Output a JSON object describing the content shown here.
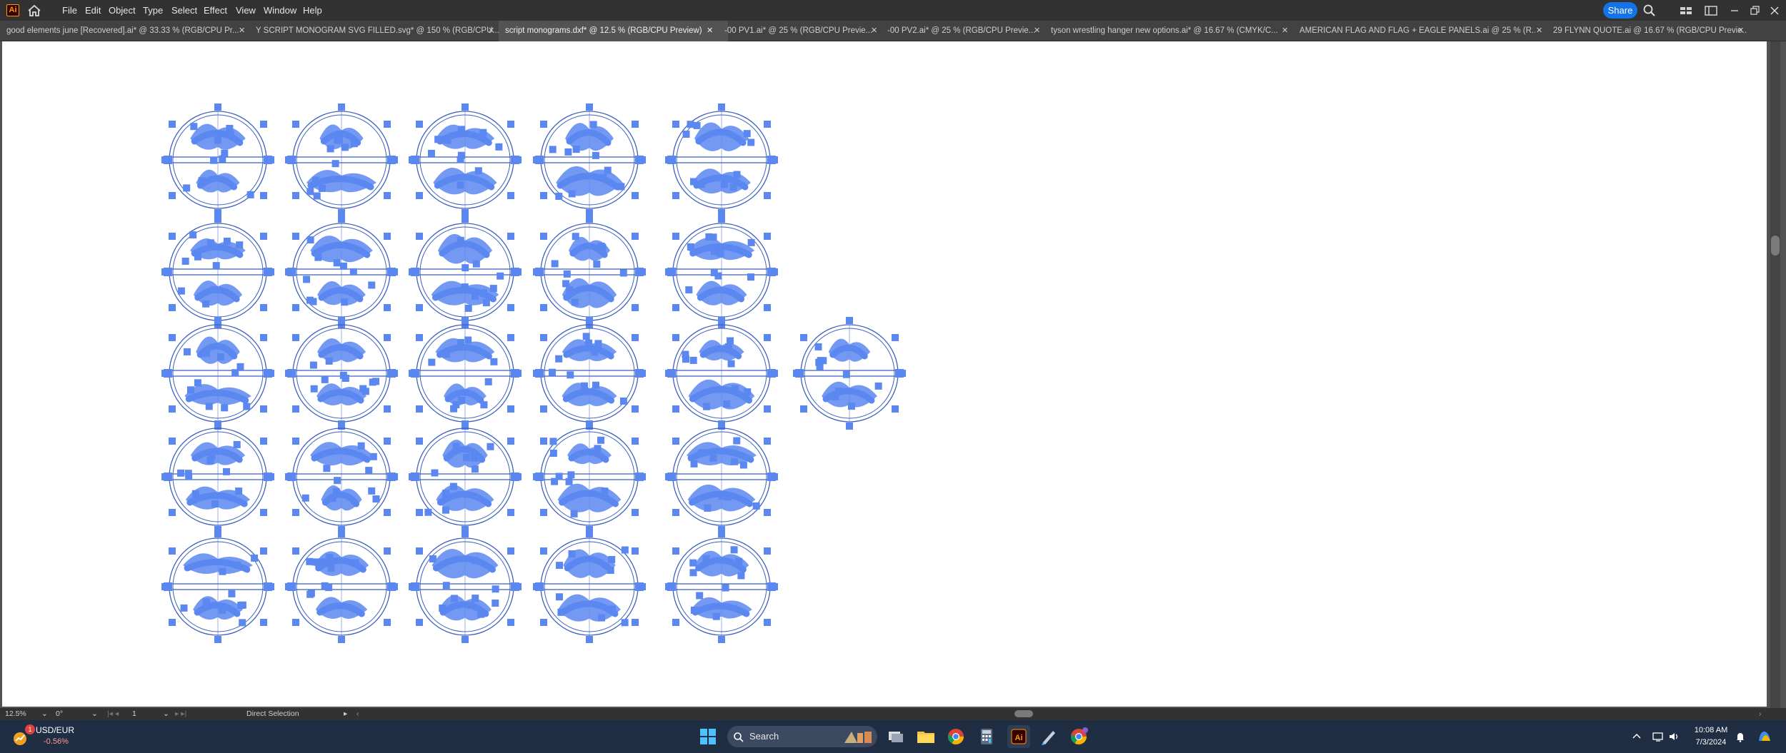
{
  "app": {
    "logo": "Ai",
    "title": "Adobe Illustrator"
  },
  "menu": [
    "File",
    "Edit",
    "Object",
    "Type",
    "Select",
    "Effect",
    "View",
    "Window",
    "Help"
  ],
  "share_label": "Share",
  "tabs": [
    {
      "label": "good elements june [Recovered].ai* @ 33.33 % (RGB/CPU Pr...",
      "active": false
    },
    {
      "label": "Y SCRIPT MONOGRAM SVG FILLED.svg* @ 150 % (RGB/CPU...",
      "active": false
    },
    {
      "label": "script monograms.dxf* @ 12.5 % (RGB/CPU Preview)",
      "active": true
    },
    {
      "label": "-00 PV1.ai* @ 25 % (RGB/CPU Previe...",
      "active": false
    },
    {
      "label": "-00 PV2.ai* @ 25 % (RGB/CPU Previe...",
      "active": false
    },
    {
      "label": "tyson wrestling hanger new options.ai* @ 16.67 % (CMYK/C...",
      "active": false
    },
    {
      "label": "AMERICAN FLAG AND FLAG + EAGLE PANELS.ai @ 25 % (R...",
      "active": false
    },
    {
      "label": "29 FLYNN QUOTE.ai @ 16.67 % (RGB/CPU Previe...",
      "active": false
    }
  ],
  "tab_close_glyph": "✕",
  "canvas": {
    "selection_color": "#5b87f0",
    "outline_color": "#3c5fc0",
    "monogram_rows": [
      5,
      5,
      6,
      5,
      5
    ]
  },
  "status": {
    "zoom": "12.5%",
    "rotation": "0°",
    "artboard_number": "1",
    "tool": "Direct Selection"
  },
  "taskbar": {
    "widget_title": "USD/EUR",
    "widget_change": "-0.56%",
    "widget_badge": "1",
    "search_placeholder": "Search",
    "time": "10:08 AM",
    "date": "7/3/2024"
  }
}
